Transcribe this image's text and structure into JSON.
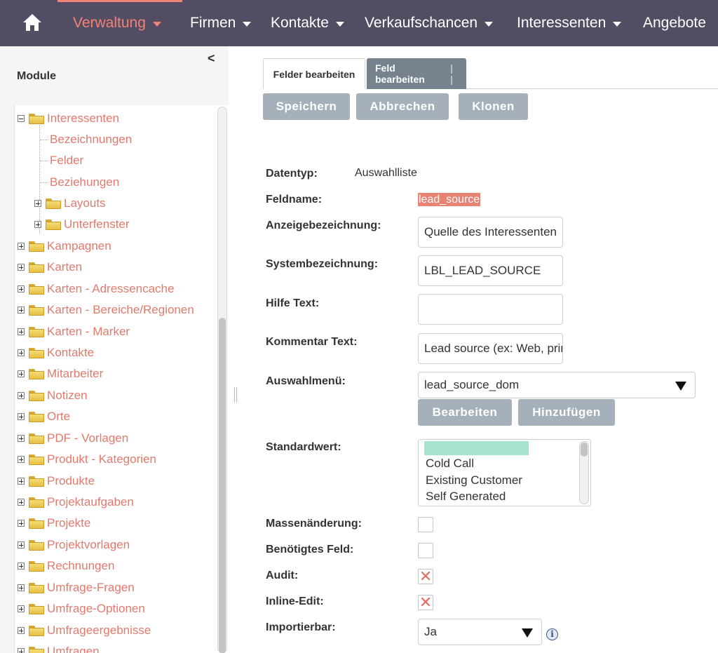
{
  "nav": {
    "items": [
      {
        "label": "Verwaltung",
        "active": true
      },
      {
        "label": "Firmen"
      },
      {
        "label": "Kontakte"
      },
      {
        "label": "Verkaufschancen"
      },
      {
        "label": "Interessenten"
      },
      {
        "label": "Angebote"
      }
    ],
    "active_color": "#f08377",
    "bar_color": "#534d64"
  },
  "sidebar": {
    "title": "Module",
    "collapse_glyph": "<",
    "tree": [
      {
        "label": "Interessenten",
        "expanded": true
      },
      {
        "label": "Bezeichnungen",
        "leaf": true
      },
      {
        "label": "Felder",
        "leaf": true
      },
      {
        "label": "Beziehungen",
        "leaf": true
      },
      {
        "label": "Layouts"
      },
      {
        "label": "Unterfenster"
      },
      {
        "label": "Kampagnen"
      },
      {
        "label": "Karten"
      },
      {
        "label": "Karten - Adressencache"
      },
      {
        "label": "Karten - Bereiche/Regionen"
      },
      {
        "label": "Karten - Marker"
      },
      {
        "label": "Kontakte"
      },
      {
        "label": "Mitarbeiter"
      },
      {
        "label": "Notizen"
      },
      {
        "label": "Orte"
      },
      {
        "label": "PDF - Vorlagen"
      },
      {
        "label": "Produkt - Kategorien"
      },
      {
        "label": "Produkte"
      },
      {
        "label": "Projektaufgaben"
      },
      {
        "label": "Projekte"
      },
      {
        "label": "Projektvorlagen"
      },
      {
        "label": "Rechnungen"
      },
      {
        "label": "Umfrage-Fragen"
      },
      {
        "label": "Umfrage-Optionen"
      },
      {
        "label": "Umfrageergebnisse"
      },
      {
        "label": "Umfragen"
      }
    ]
  },
  "tabs": {
    "fields": "Felder bearbeiten",
    "field": "Feld bearbeiten",
    "field_sep": "| |"
  },
  "buttons": {
    "save": "Speichern",
    "cancel": "Abbrechen",
    "clone": "Klonen",
    "edit": "Bearbeiten",
    "add": "Hinzufügen"
  },
  "form": {
    "datatype_label": "Datentyp:",
    "datatype_value": "Auswahlliste",
    "fieldname_label": "Feldname:",
    "fieldname_value": "lead_source",
    "display_label": "Anzeigebezeichnung:",
    "display_value": "Quelle des Interessenten",
    "system_label": "Systembezeichnung:",
    "system_value": "LBL_LEAD_SOURCE",
    "help_label": "Hilfe Text:",
    "help_value": "",
    "comment_label": "Kommentar Text:",
    "comment_value": "Lead source (ex: Web, print)",
    "dropdown_label": "Auswahlmenü:",
    "dropdown_value": "lead_source_dom",
    "default_label": "Standardwert:",
    "default_options": [
      "Cold Call",
      "Existing Customer",
      "Self Generated"
    ],
    "massupdate_label": "Massenänderung:",
    "massupdate_checked": false,
    "required_label": "Benötigtes Feld:",
    "required_checked": false,
    "audit_label": "Audit:",
    "audit_checked": true,
    "inline_label": "Inline-Edit:",
    "inline_checked": true,
    "import_label": "Importierbar:",
    "import_value": "Ja"
  }
}
